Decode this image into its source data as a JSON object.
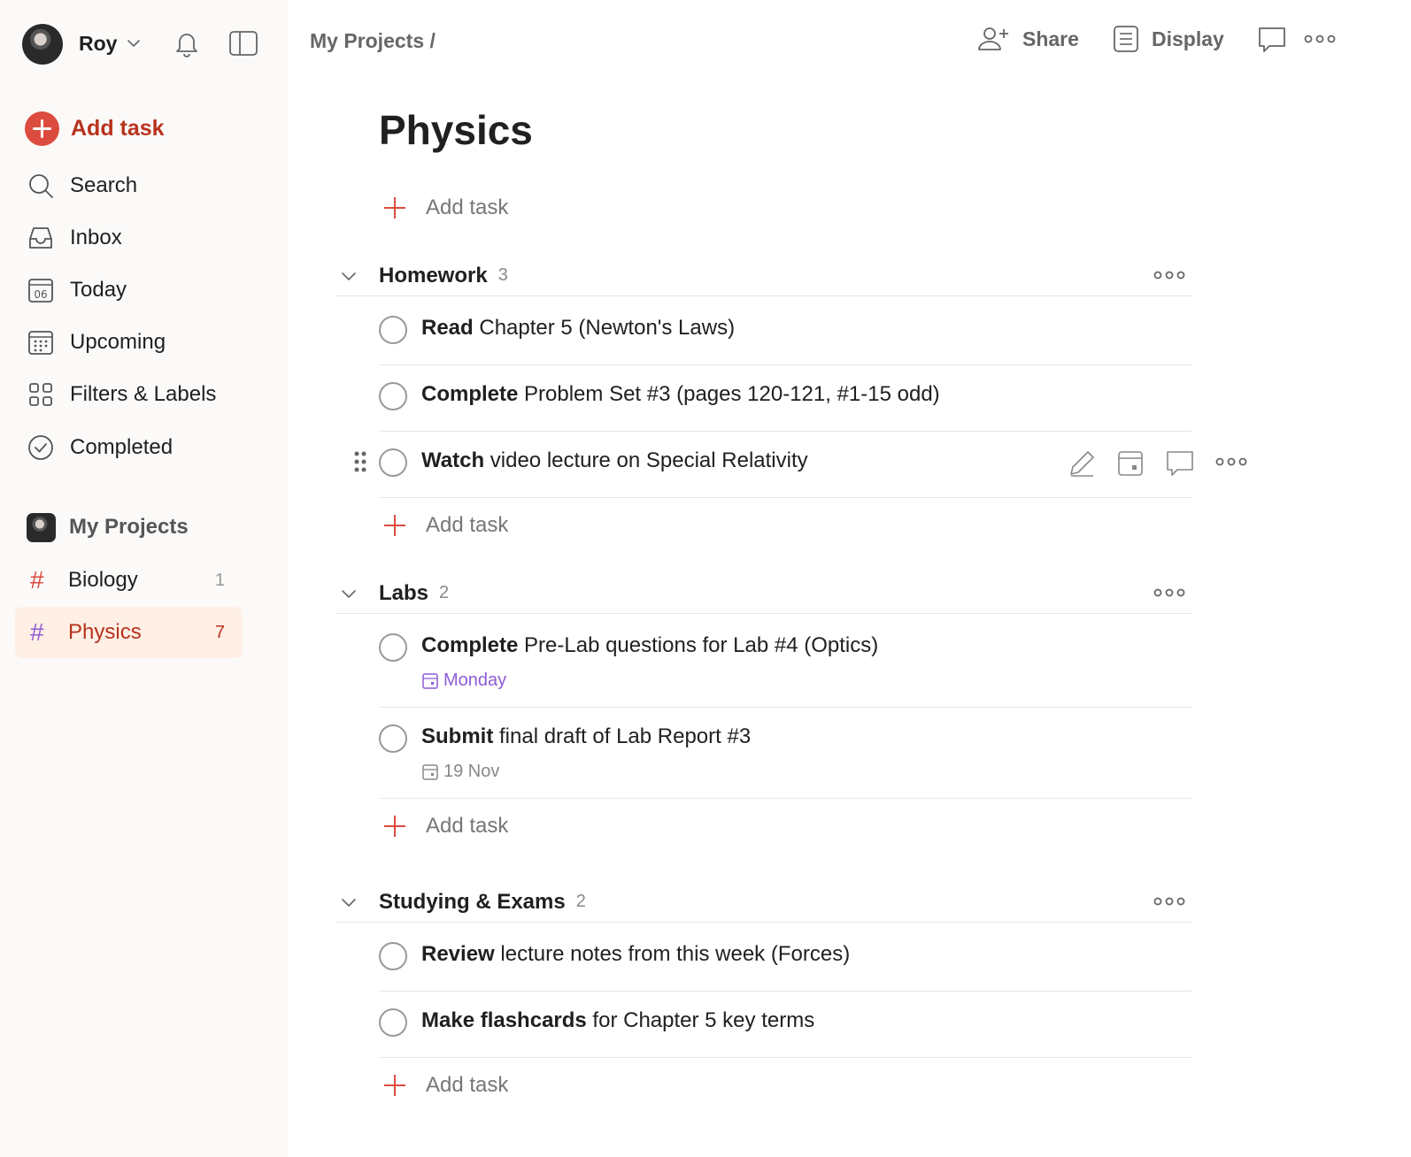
{
  "sidebar": {
    "user_name": "Roy",
    "add_task_label": "Add task",
    "nav": [
      {
        "label": "Search",
        "icon": "search-icon"
      },
      {
        "label": "Inbox",
        "icon": "inbox-icon"
      },
      {
        "label": "Today",
        "icon": "calendar-today-icon",
        "day": "06"
      },
      {
        "label": "Upcoming",
        "icon": "calendar-grid-icon"
      },
      {
        "label": "Filters & Labels",
        "icon": "filters-grid-icon"
      },
      {
        "label": "Completed",
        "icon": "check-circle-icon"
      }
    ],
    "projects_label": "My Projects",
    "projects": [
      {
        "name": "Biology",
        "count": "1",
        "hash": "#"
      },
      {
        "name": "Physics",
        "count": "7",
        "hash": "#",
        "active": true
      }
    ]
  },
  "header": {
    "breadcrumb": "My Projects /",
    "share_label": "Share",
    "display_label": "Display"
  },
  "main": {
    "title": "Physics",
    "add_task_label": "Add task",
    "sections": [
      {
        "name": "Homework",
        "count": "3",
        "tasks": [
          {
            "verb": "Read",
            "rest": " Chapter 5 (Newton's Laws)"
          },
          {
            "verb": "Complete",
            "rest": " Problem Set #3 (pages 120-121, #1-15 odd)"
          },
          {
            "verb": "Watch",
            "rest": " video lecture on Special Relativity"
          }
        ]
      },
      {
        "name": "Labs",
        "count": "2",
        "tasks": [
          {
            "verb": "Complete",
            "rest": " Pre-Lab questions for Lab #4 (Optics)",
            "due": "Monday"
          },
          {
            "verb": "Submit",
            "rest": " final draft of Lab Report #3",
            "due": "19 Nov"
          }
        ]
      },
      {
        "name": "Studying & Exams",
        "count": "2",
        "tasks": [
          {
            "verb": "Review",
            "rest": " lecture notes from this week (Forces)"
          },
          {
            "verb": "Make flashcards",
            "rest": " for Chapter 5 key terms"
          }
        ]
      }
    ]
  },
  "colors": {
    "accent": "#dc4c3e",
    "accent_text": "#b8321d",
    "active_bg": "#ffefe5",
    "sidebar_bg": "#fcfaf8",
    "date_purple": "#8e5cd6"
  }
}
